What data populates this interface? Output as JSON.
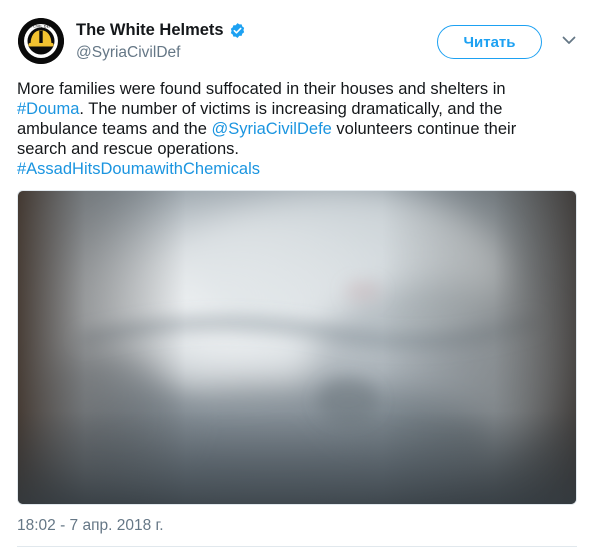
{
  "user": {
    "display_name": "The White Helmets",
    "handle": "@SyriaCivilDef",
    "verified": true,
    "avatar_icon": "white-helmets-logo-icon"
  },
  "actions": {
    "follow_label": "Читать",
    "more_icon": "chevron-down-icon"
  },
  "tweet": {
    "segments": [
      {
        "type": "text",
        "text": "More families were found suffocated in their houses and shelters in"
      },
      {
        "type": "hashtag",
        "text": "#Douma"
      },
      {
        "type": "text",
        "text": ". The number of victims is increasing dramatically, and the"
      },
      {
        "type": "text",
        "text": "ambulance teams and the "
      },
      {
        "type": "mention",
        "text": "@SyriaCivilDefe"
      },
      {
        "type": "text",
        "text": " volunteers continue their"
      },
      {
        "type": "text",
        "text": "search and rescue operations."
      },
      {
        "type": "hashtag",
        "text": "#AssadHitsDoumawithChemicals"
      }
    ]
  },
  "media": {
    "type": "video-thumbnail"
  },
  "timestamp": "18:02 - 7 апр. 2018 г.",
  "colors": {
    "accent": "#1da1f2",
    "link": "#1b95e0",
    "text": "#14171a",
    "secondary": "#657786",
    "border": "#e1e8ed",
    "verified": "#1da1f2"
  }
}
